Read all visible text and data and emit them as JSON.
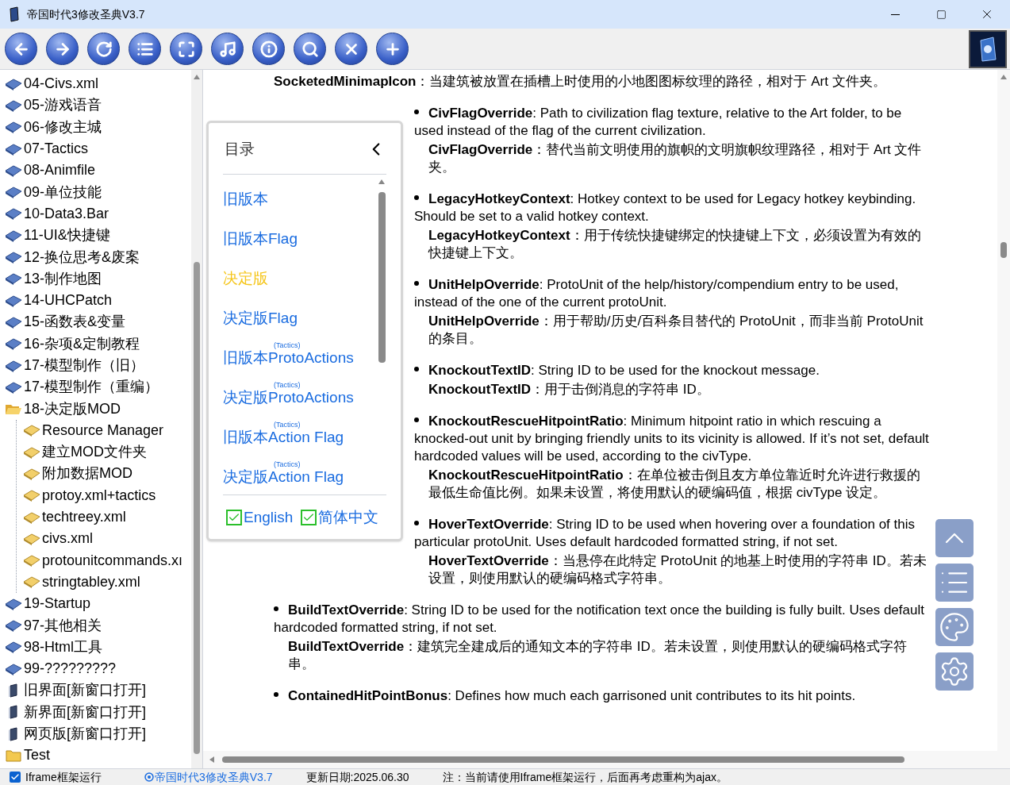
{
  "window": {
    "title": "帝国时代3修改圣典V3.7"
  },
  "toolbar": {
    "buttons": [
      {
        "kind": "back"
      },
      {
        "kind": "forward"
      },
      {
        "kind": "refresh"
      },
      {
        "kind": "list"
      },
      {
        "kind": "fullscreen"
      },
      {
        "kind": "music"
      },
      {
        "kind": "info"
      },
      {
        "kind": "search"
      },
      {
        "kind": "close"
      },
      {
        "kind": "add"
      }
    ]
  },
  "sidebar": {
    "items": [
      {
        "label": "04-Civs.xml",
        "kind": "book"
      },
      {
        "label": "05-游戏语音",
        "kind": "book"
      },
      {
        "label": "06-修改主城",
        "kind": "book"
      },
      {
        "label": "07-Tactics",
        "kind": "book"
      },
      {
        "label": "08-Animfile",
        "kind": "book"
      },
      {
        "label": "09-单位技能",
        "kind": "book"
      },
      {
        "label": "10-Data3.Bar",
        "kind": "book"
      },
      {
        "label": "11-UI&快捷键",
        "kind": "book"
      },
      {
        "label": "12-换位思考&废案",
        "kind": "book"
      },
      {
        "label": "13-制作地图",
        "kind": "book"
      },
      {
        "label": "14-UHCPatch",
        "kind": "book"
      },
      {
        "label": "15-函数表&变量",
        "kind": "book"
      },
      {
        "label": "16-杂项&定制教程",
        "kind": "book"
      },
      {
        "label": "17-模型制作（旧）",
        "kind": "book"
      },
      {
        "label": "17-模型制作（重编）",
        "kind": "book"
      },
      {
        "label": "18-决定版MOD",
        "kind": "folder",
        "expanded": true,
        "children": [
          {
            "label": "Resource Manager",
            "kind": "page"
          },
          {
            "label": "建立MOD文件夹",
            "kind": "page"
          },
          {
            "label": "附加数据MOD",
            "kind": "page"
          },
          {
            "label": "protoy.xml+tactics",
            "kind": "page"
          },
          {
            "label": "techtreey.xml",
            "kind": "page"
          },
          {
            "label": "civs.xml",
            "kind": "page"
          },
          {
            "label": "protounitcommands.xı",
            "kind": "page"
          },
          {
            "label": "stringtabley.xml",
            "kind": "page"
          }
        ]
      },
      {
        "label": "19-Startup",
        "kind": "book"
      },
      {
        "label": "97-其他相关",
        "kind": "book"
      },
      {
        "label": "98-Html工具",
        "kind": "book"
      },
      {
        "label": "99-?????????",
        "kind": "book"
      },
      {
        "label": "旧界面[新窗口打开]",
        "kind": "link"
      },
      {
        "label": "新界面[新窗口打开]",
        "kind": "link"
      },
      {
        "label": "网页版[新窗口打开]",
        "kind": "link"
      },
      {
        "label": "Test",
        "kind": "folder",
        "expanded": false
      }
    ]
  },
  "content": {
    "entries": [
      {
        "bullet": false,
        "zh": "**SocketedMinimapIcon**：当建筑被放置在插槽上时使用的小地图图标纹理的路径，相对于 Art 文件夹。"
      },
      {
        "bullet": true,
        "en": "**CivFlagOverride**: Path to civilization flag texture, relative to the Art folder, to be used instead of the flag of the current civilization.",
        "zh": "**CivFlagOverride**：替代当前文明使用的旗帜的文明旗帜纹理路径，相对于 Art 文件夹。"
      },
      {
        "bullet": true,
        "en": "**LegacyHotkeyContext**: Hotkey context to be used for Legacy hotkey keybinding. Should be set to a valid hotkey context.",
        "zh": "**LegacyHotkeyContext**：用于传统快捷键绑定的快捷键上下文，必须设置为有效的快捷键上下文。"
      },
      {
        "bullet": true,
        "en": "**UnitHelpOverride**: ProtoUnit of the help/history/compendium entry to be used, instead of the one of the current protoUnit.",
        "zh": "**UnitHelpOverride**：用于帮助/历史/百科条目替代的 ProtoUnit，而非当前 ProtoUnit 的条目。"
      },
      {
        "bullet": true,
        "en": "**KnockoutTextID**: String ID to be used for the knockout message.",
        "zh": "**KnockoutTextID**：用于击倒消息的字符串 ID。"
      },
      {
        "bullet": true,
        "en": "**KnockoutRescueHitpointRatio**: Minimum hitpoint ratio in which rescuing a knocked-out unit by bringing friendly units to its vicinity is allowed. If it’s not set, default hardcoded values will be used, according to the civType.",
        "zh": "**KnockoutRescueHitpointRatio**：在单位被击倒且友方单位靠近时允许进行救援的最低生命值比例。如果未设置，将使用默认的硬编码值，根据 civType 设定。"
      },
      {
        "bullet": true,
        "en": "**HoverTextOverride**: String ID to be used when hovering over a foundation of this particular protoUnit. Uses default hardcoded formatted string, if not set.",
        "zh": "**HoverTextOverride**：当悬停在此特定 ProtoUnit 的地基上时使用的字符串 ID。若未设置，则使用默认的硬编码格式字符串。"
      },
      {
        "bullet": true,
        "en": "**BuildTextOverride**: String ID to be used for the notification text once the building is fully built. Uses default hardcoded formatted string, if not set.",
        "zh": "**BuildTextOverride**：建筑完全建成后的通知文本的字符串 ID。若未设置，则使用默认的硬编码格式字符串。"
      },
      {
        "bullet": true,
        "en": "**ContainedHitPointBonus**: Defines how much each garrisoned unit contributes to its hit points."
      }
    ]
  },
  "toc": {
    "title": "目录",
    "items": [
      {
        "label": "旧版本",
        "selected": false
      },
      {
        "label": "旧版本Flag",
        "selected": false
      },
      {
        "label": "决定版",
        "selected": true
      },
      {
        "label": "决定版Flag",
        "selected": false
      },
      {
        "label": "旧版本ProtoActions",
        "note": "(Tactics)",
        "selected": false
      },
      {
        "label": "决定版ProtoActions",
        "note": "(Tactics)",
        "selected": false
      },
      {
        "label": "旧版本Action Flag",
        "note": "(Tactics)",
        "selected": false
      },
      {
        "label": "决定版Action Flag",
        "note": "(Tactics)",
        "selected": false
      }
    ],
    "languages": [
      {
        "label": "English",
        "checked": true
      },
      {
        "label": "简体中文",
        "checked": true
      }
    ]
  },
  "floating": {
    "buttons": [
      {
        "kind": "top"
      },
      {
        "kind": "list"
      },
      {
        "kind": "palette"
      },
      {
        "kind": "settings"
      }
    ]
  },
  "status_bar": {
    "iframe": {
      "label": "Iframe框架运行",
      "checked": true
    },
    "link": "帝国时代3修改圣典V3.7",
    "updated": "更新日期:2025.06.30",
    "note": "注：当前请使用Iframe框架运行，后面再考虑重构为ajax。"
  }
}
